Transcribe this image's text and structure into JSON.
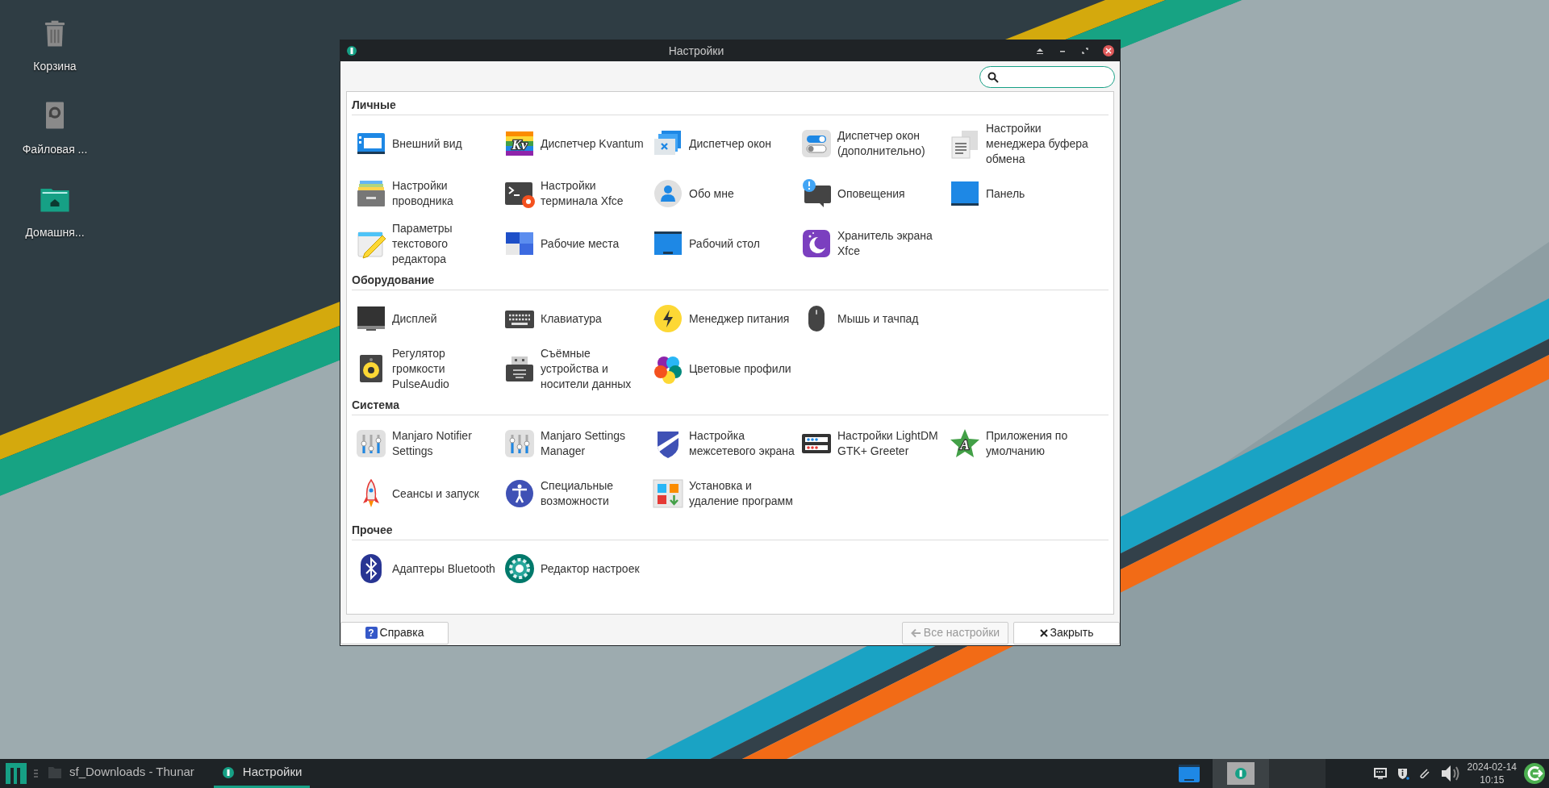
{
  "desktop_icons": [
    {
      "label": "Корзина"
    },
    {
      "label": "Файловая ..."
    },
    {
      "label": "Домашня..."
    }
  ],
  "window": {
    "title": "Настройки"
  },
  "sections": [
    {
      "title": "Личные",
      "items": [
        {
          "label": "Внешний вид"
        },
        {
          "label": "Диспетчер Kvantum",
          "icon_text": "Kv"
        },
        {
          "label": "Диспетчер окон"
        },
        {
          "label": "Диспетчер окон (дополнительно)"
        },
        {
          "label": "Настройки менеджера буфера обмена"
        },
        {
          "label": "Настройки проводника"
        },
        {
          "label": "Настройки терминала Xfce"
        },
        {
          "label": "Обо мне"
        },
        {
          "label": "Оповещения"
        },
        {
          "label": "Панель"
        },
        {
          "label": "Параметры текстового редактора"
        },
        {
          "label": "Рабочие места"
        },
        {
          "label": "Рабочий стол"
        },
        {
          "label": "Хранитель экрана Xfce"
        }
      ]
    },
    {
      "title": "Оборудование",
      "items": [
        {
          "label": "Дисплей"
        },
        {
          "label": "Клавиатура"
        },
        {
          "label": "Менеджер питания"
        },
        {
          "label": "Мышь и тачпад"
        },
        {
          "label": "Регулятор громкости PulseAudio"
        },
        {
          "label": "Съёмные устройства и носители данных"
        },
        {
          "label": "Цветовые профили"
        }
      ]
    },
    {
      "title": "Система",
      "items": [
        {
          "label": "Manjaro Notifier Settings"
        },
        {
          "label": "Manjaro Settings Manager"
        },
        {
          "label": "Настройка межсетевого экрана"
        },
        {
          "label": "Настройки LightDM GTK+ Greeter"
        },
        {
          "label": "Приложения по умолчанию",
          "icon_text": "A"
        },
        {
          "label": "Сеансы и запуск"
        },
        {
          "label": "Специальные возможности"
        },
        {
          "label": "Установка и удаление программ"
        }
      ]
    },
    {
      "title": "Прочее",
      "items": [
        {
          "label": "Адаптеры Bluetooth"
        },
        {
          "label": "Редактор настроек"
        }
      ]
    }
  ],
  "footer": {
    "help": {
      "label": "Справка",
      "icon_text": "?"
    },
    "all_settings": {
      "label": "Все настройки",
      "disabled": true
    },
    "close": {
      "label": "Закрыть"
    }
  },
  "taskbar": {
    "tasks": [
      {
        "label": "sf_Downloads - Thunar",
        "selected": false
      },
      {
        "label": "Настройки",
        "selected": true
      }
    ],
    "workspaces": [
      {
        "selected": true
      },
      {
        "selected": false
      }
    ],
    "clock": {
      "date": "2024-02-14",
      "time": "10:15"
    }
  }
}
